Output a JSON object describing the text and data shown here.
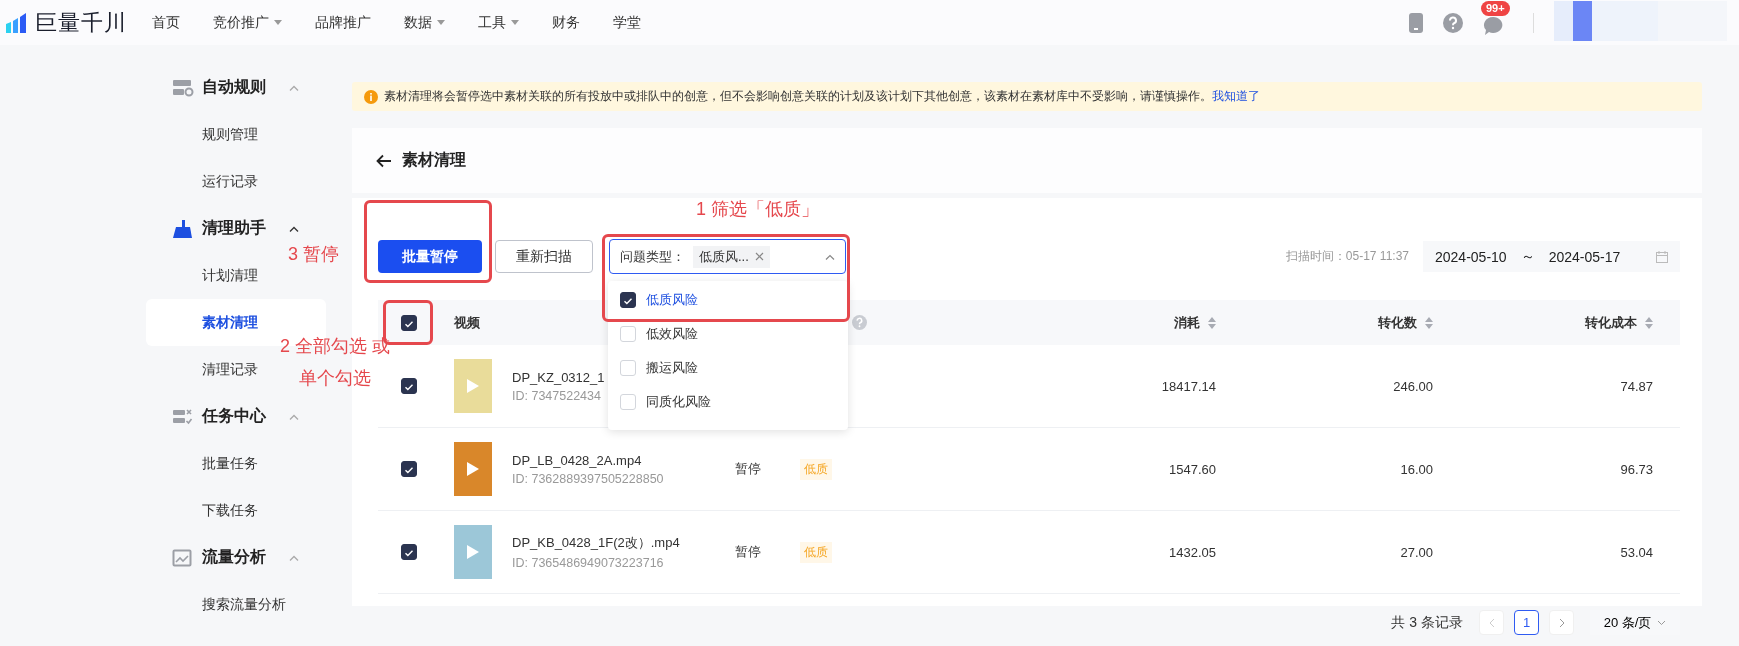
{
  "topbar": {
    "logo": "巨量千川",
    "nav": [
      {
        "label": "首页",
        "has_menu": false
      },
      {
        "label": "竞价推广",
        "has_menu": true
      },
      {
        "label": "品牌推广",
        "has_menu": false
      },
      {
        "label": "数据",
        "has_menu": true
      },
      {
        "label": "工具",
        "has_menu": true
      },
      {
        "label": "财务",
        "has_menu": false
      },
      {
        "label": "学堂",
        "has_menu": false
      }
    ],
    "notification_badge": "99+"
  },
  "sidebar": {
    "groups": [
      {
        "title": "自动规则",
        "active": false,
        "expanded": true,
        "items": [
          {
            "label": "规则管理",
            "selected": false
          },
          {
            "label": "运行记录",
            "selected": false
          }
        ]
      },
      {
        "title": "清理助手",
        "active": true,
        "expanded": true,
        "items": [
          {
            "label": "计划清理",
            "selected": false
          },
          {
            "label": "素材清理",
            "selected": true
          },
          {
            "label": "清理记录",
            "selected": false
          }
        ]
      },
      {
        "title": "任务中心",
        "active": false,
        "expanded": true,
        "items": [
          {
            "label": "批量任务",
            "selected": false
          },
          {
            "label": "下载任务",
            "selected": false
          }
        ]
      },
      {
        "title": "流量分析",
        "active": false,
        "expanded": true,
        "items": [
          {
            "label": "搜索流量分析",
            "selected": false
          }
        ]
      }
    ]
  },
  "notice": {
    "text": "素材清理将会暂停选中素材关联的所有投放中或排队中的创意，但不会影响创意关联的计划及该计划下其他创意，该素材在素材库中不受影响，请谨慎操作。",
    "link": "我知道了"
  },
  "page": {
    "title": "素材清理"
  },
  "toolbar": {
    "primary_button": "批量暂停",
    "secondary_button": "重新扫描",
    "filter": {
      "label": "问题类型：",
      "tag": "低质风...",
      "expanded": true,
      "options": [
        {
          "label": "低质风险",
          "checked": true
        },
        {
          "label": "低效风险",
          "checked": false
        },
        {
          "label": "搬运风险",
          "checked": false
        },
        {
          "label": "同质化风险",
          "checked": false
        }
      ]
    },
    "scan_time": "扫描时间：05-17 11:37",
    "date_start": "2024-05-10",
    "date_separator": "～",
    "date_end": "2024-05-17"
  },
  "table": {
    "all_checked": true,
    "columns": [
      {
        "label": "视频",
        "sortable": false
      },
      {
        "label": "消耗",
        "sortable": true
      },
      {
        "label": "转化数",
        "sortable": true
      },
      {
        "label": "转化成本",
        "sortable": true
      }
    ],
    "rows": [
      {
        "checked": true,
        "name": "DP_KZ_0312_1",
        "id": "ID: 7347522434",
        "cost": "18417.14",
        "conversions": "246.00",
        "cpa": "74.87"
      },
      {
        "checked": true,
        "name": "DP_LB_0428_2A.mp4",
        "id": "ID: 7362889397505228850",
        "status": "暂停",
        "tag": "低质",
        "cost": "1547.60",
        "conversions": "16.00",
        "cpa": "96.73"
      },
      {
        "checked": true,
        "name": "DP_KB_0428_1F(2改）.mp4",
        "id": "ID: 7365486949073223716",
        "status": "暂停",
        "tag": "低质",
        "cost": "1432.05",
        "conversions": "27.00",
        "cpa": "53.04"
      }
    ]
  },
  "pagination": {
    "total": "共 3 条记录",
    "page": "1",
    "page_size": "20 条/页"
  },
  "annotations": [
    {
      "lines": [
        "1 筛选「低质」"
      ]
    },
    {
      "lines": [
        "3 暂停"
      ]
    },
    {
      "lines": [
        "2 全部勾选 或",
        "单个勾选"
      ]
    }
  ]
}
